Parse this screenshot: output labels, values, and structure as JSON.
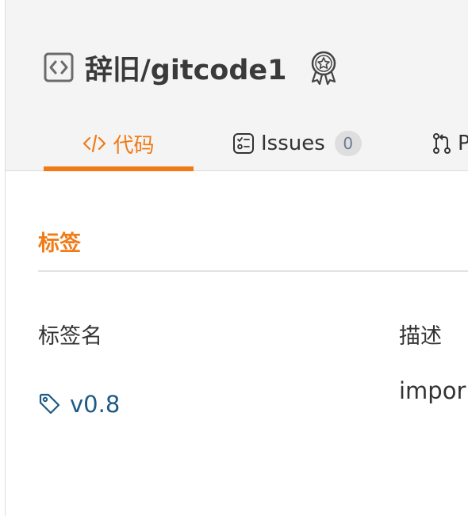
{
  "repo": {
    "title": "辞旧/gitcode1",
    "icon": "code-square-icon",
    "badge_icon": "award-ribbon-icon"
  },
  "tabs": [
    {
      "label": "代码",
      "icon": "code-icon",
      "active": true
    },
    {
      "label": "Issues",
      "icon": "checklist-icon",
      "count": "0"
    },
    {
      "label": "Pu",
      "icon": "pull-request-icon"
    }
  ],
  "section": {
    "title": "标签"
  },
  "table": {
    "headers": [
      "标签名",
      "描述"
    ],
    "rows": [
      {
        "tag": "v0.8",
        "description": "impor",
        "icon": "tag-icon"
      }
    ]
  },
  "colors": {
    "accent": "#f27a14",
    "link": "#1d5a86",
    "header_bg": "#f4f4f4"
  }
}
